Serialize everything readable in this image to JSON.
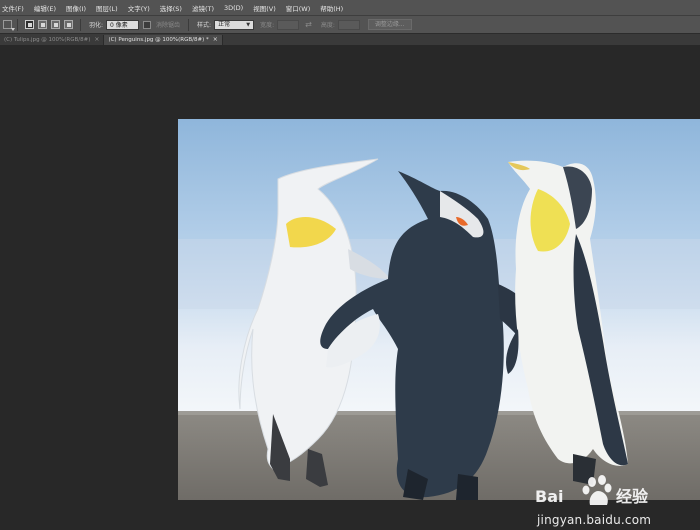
{
  "menubar": {
    "items": [
      "文件(F)",
      "编辑(E)",
      "图像(I)",
      "图层(L)",
      "文字(Y)",
      "选择(S)",
      "滤镜(T)",
      "3D(D)",
      "视图(V)",
      "窗口(W)",
      "帮助(H)"
    ]
  },
  "options": {
    "feather_label": "羽化:",
    "feather_value": "0 像素",
    "antialias_label": "消除锯齿",
    "style_label": "样式:",
    "style_value": "正常",
    "width_label": "宽度:",
    "height_label": "高度:",
    "refine_edge_label": "调整边缘..."
  },
  "tabs": [
    {
      "label": "(C) Tulips.jpg @ 100%(RGB/8#)",
      "close": "×"
    },
    {
      "label": "(C) Penguins.jpg @ 100%(RGB/8#) *",
      "close": "×"
    }
  ],
  "watermark": {
    "brand": "Bai 经验",
    "url": "jingyan.baidu.com"
  },
  "colors": {
    "menubar_bg": "#535353",
    "canvas_bg": "#282828",
    "sky": "#9fc3e3",
    "sand": "#8a8780"
  }
}
